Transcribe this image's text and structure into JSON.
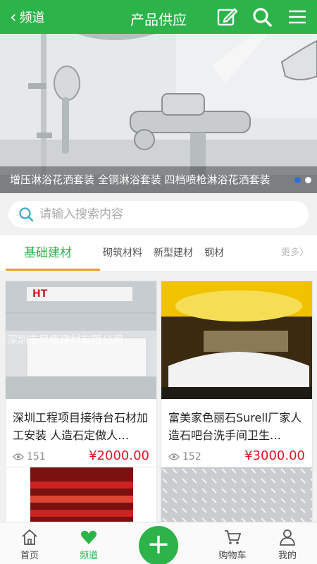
{
  "header": {
    "back_label": "频道",
    "title": "产品供应",
    "icons": [
      "edit-icon",
      "search-icon",
      "menu-icon"
    ]
  },
  "banner": {
    "caption": "增压淋浴花洒套装 全铜淋浴套装 四档喷枪淋浴花洒套装",
    "slides": 2,
    "active_slide": 1
  },
  "search": {
    "placeholder": "请输入搜索内容"
  },
  "tabs": {
    "items": [
      "基础建材",
      "砌筑材料",
      "新型建材",
      "钢材"
    ],
    "active": 0,
    "more": "更多"
  },
  "products": [
    {
      "name": "深圳工程项目接待台石材加工安装 人造石定做人…",
      "views": "151",
      "price": "¥2000.00",
      "image_text": "深圳市早隼建材有限公司",
      "logo_text": "HT"
    },
    {
      "name": "富美家色丽石Surell厂家人造石吧台洗手间卫生…",
      "views": "152",
      "price": "¥3000.00"
    },
    {
      "name": "",
      "views": "",
      "price": ""
    },
    {
      "name": "",
      "views": "",
      "price": ""
    }
  ],
  "bottom_nav": {
    "items": [
      {
        "label": "首页",
        "icon": "home-icon"
      },
      {
        "label": "频道",
        "icon": "heart-icon"
      },
      {
        "label": "购物车",
        "icon": "cart-icon"
      },
      {
        "label": "我的",
        "icon": "user-icon"
      }
    ],
    "fab": "+"
  },
  "colors": {
    "brand_green": "#2cb34a",
    "price_red": "#e2161e",
    "tab_underline": "#f29b2f"
  }
}
